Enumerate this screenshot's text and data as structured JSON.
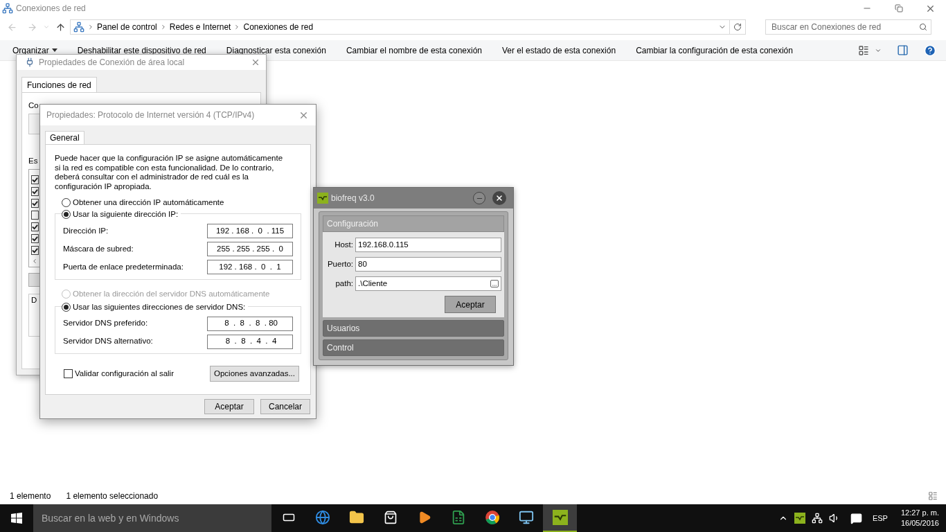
{
  "explorer": {
    "title": "Conexiones de red",
    "breadcrumb": [
      "Panel de control",
      "Redes e Internet",
      "Conexiones de red"
    ],
    "search": {
      "placeholder": "Buscar en Conexiones de red"
    },
    "toolbar": [
      {
        "label": "Organizar",
        "kind": "menu"
      },
      {
        "label": "Deshabilitar este dispositivo de red",
        "kind": "command"
      },
      {
        "label": "Diagnosticar esta conexión",
        "kind": "command"
      },
      {
        "label": "Cambiar el nombre de esta conexión",
        "kind": "command"
      },
      {
        "label": "Ver el estado de esta conexión",
        "kind": "command"
      },
      {
        "label": "Cambiar la configuración de esta conexión",
        "kind": "command"
      }
    ],
    "status_bar": [
      "1 elemento",
      "1 elemento seleccionado"
    ]
  },
  "local_dialog": {
    "title": "Propiedades de Conexión de área local",
    "tabs": [
      {
        "label": "Funciones de red",
        "selected": true
      }
    ],
    "label_1": "Co",
    "label_2": "Es",
    "label_3": "D",
    "items": [
      {
        "checked": true
      },
      {
        "checked": true
      },
      {
        "checked": true
      },
      {
        "checked": false
      },
      {
        "checked": true
      },
      {
        "checked": true
      },
      {
        "checked": true
      }
    ]
  },
  "ipv4_dialog": {
    "title": "Propiedades: Protocolo de Internet versión 4 (TCP/IPv4)",
    "tabs": [
      {
        "label": "General",
        "selected": true
      }
    ],
    "description": "Puede hacer que la configuración IP se asigne automáticamente si la red es compatible con esta funcionalidad. De lo contrario, deberá consultar con el administrador de red cuál es la configuración IP apropiada.",
    "ip_auto": {
      "label": "Obtener una dirección IP automáticamente",
      "selected": false,
      "disabled": false
    },
    "ip_manual": {
      "label": "Usar la siguiente dirección IP:",
      "selected": true,
      "disabled": false
    },
    "ip_fields": [
      {
        "label": "Dirección IP:",
        "value": "192 . 168 .  0  . 115"
      },
      {
        "label": "Máscara de subred:",
        "value": "255 . 255 . 255 .  0"
      },
      {
        "label": "Puerta de enlace predeterminada:",
        "value": "192 . 168 .  0  .  1"
      }
    ],
    "dns_auto": {
      "label": "Obtener la dirección del servidor DNS automáticamente",
      "selected": false,
      "disabled": true
    },
    "dns_manual": {
      "label": "Usar las siguientes direcciones de servidor DNS:",
      "selected": true,
      "disabled": false
    },
    "dns_fields": [
      {
        "label": "Servidor DNS preferido:",
        "value": " 8  .  8  .  8  . 80"
      },
      {
        "label": "Servidor DNS alternativo:",
        "value": " 8  .  8  .  4  .  4"
      }
    ],
    "validate": {
      "label": "Validar configuración al salir",
      "checked": false
    },
    "advanced_button": "Opciones avanzadas...",
    "ok_button": "Aceptar",
    "cancel_button": "Cancelar"
  },
  "biofreq": {
    "title": "biofreq v3.0",
    "sections": [
      {
        "label": "Configuración",
        "expanded": true,
        "fields": [
          {
            "label": "Host:",
            "value": "192.168.0.115",
            "kind": "text"
          },
          {
            "label": "Puerto:",
            "value": "80",
            "kind": "text"
          },
          {
            "label": "path:",
            "value": ".\\Cliente",
            "kind": "browse"
          }
        ],
        "button": "Aceptar"
      },
      {
        "label": "Usuarios",
        "expanded": false
      },
      {
        "label": "Control",
        "expanded": false
      }
    ]
  },
  "taskbar": {
    "search": {
      "placeholder": "Buscar en la web y en Windows"
    },
    "apps": [
      {
        "kind": "taskview",
        "selected": false
      },
      {
        "kind": "edge",
        "selected": false
      },
      {
        "kind": "folder",
        "selected": false
      },
      {
        "kind": "store",
        "selected": false
      },
      {
        "kind": "media",
        "selected": false
      },
      {
        "kind": "sheet",
        "selected": false
      },
      {
        "kind": "chrome",
        "selected": false
      },
      {
        "kind": "monitor",
        "selected": false
      },
      {
        "kind": "biofreq",
        "selected": true
      }
    ],
    "language": "ESP",
    "time": "12:27 p. m.",
    "date": "16/05/2016"
  }
}
